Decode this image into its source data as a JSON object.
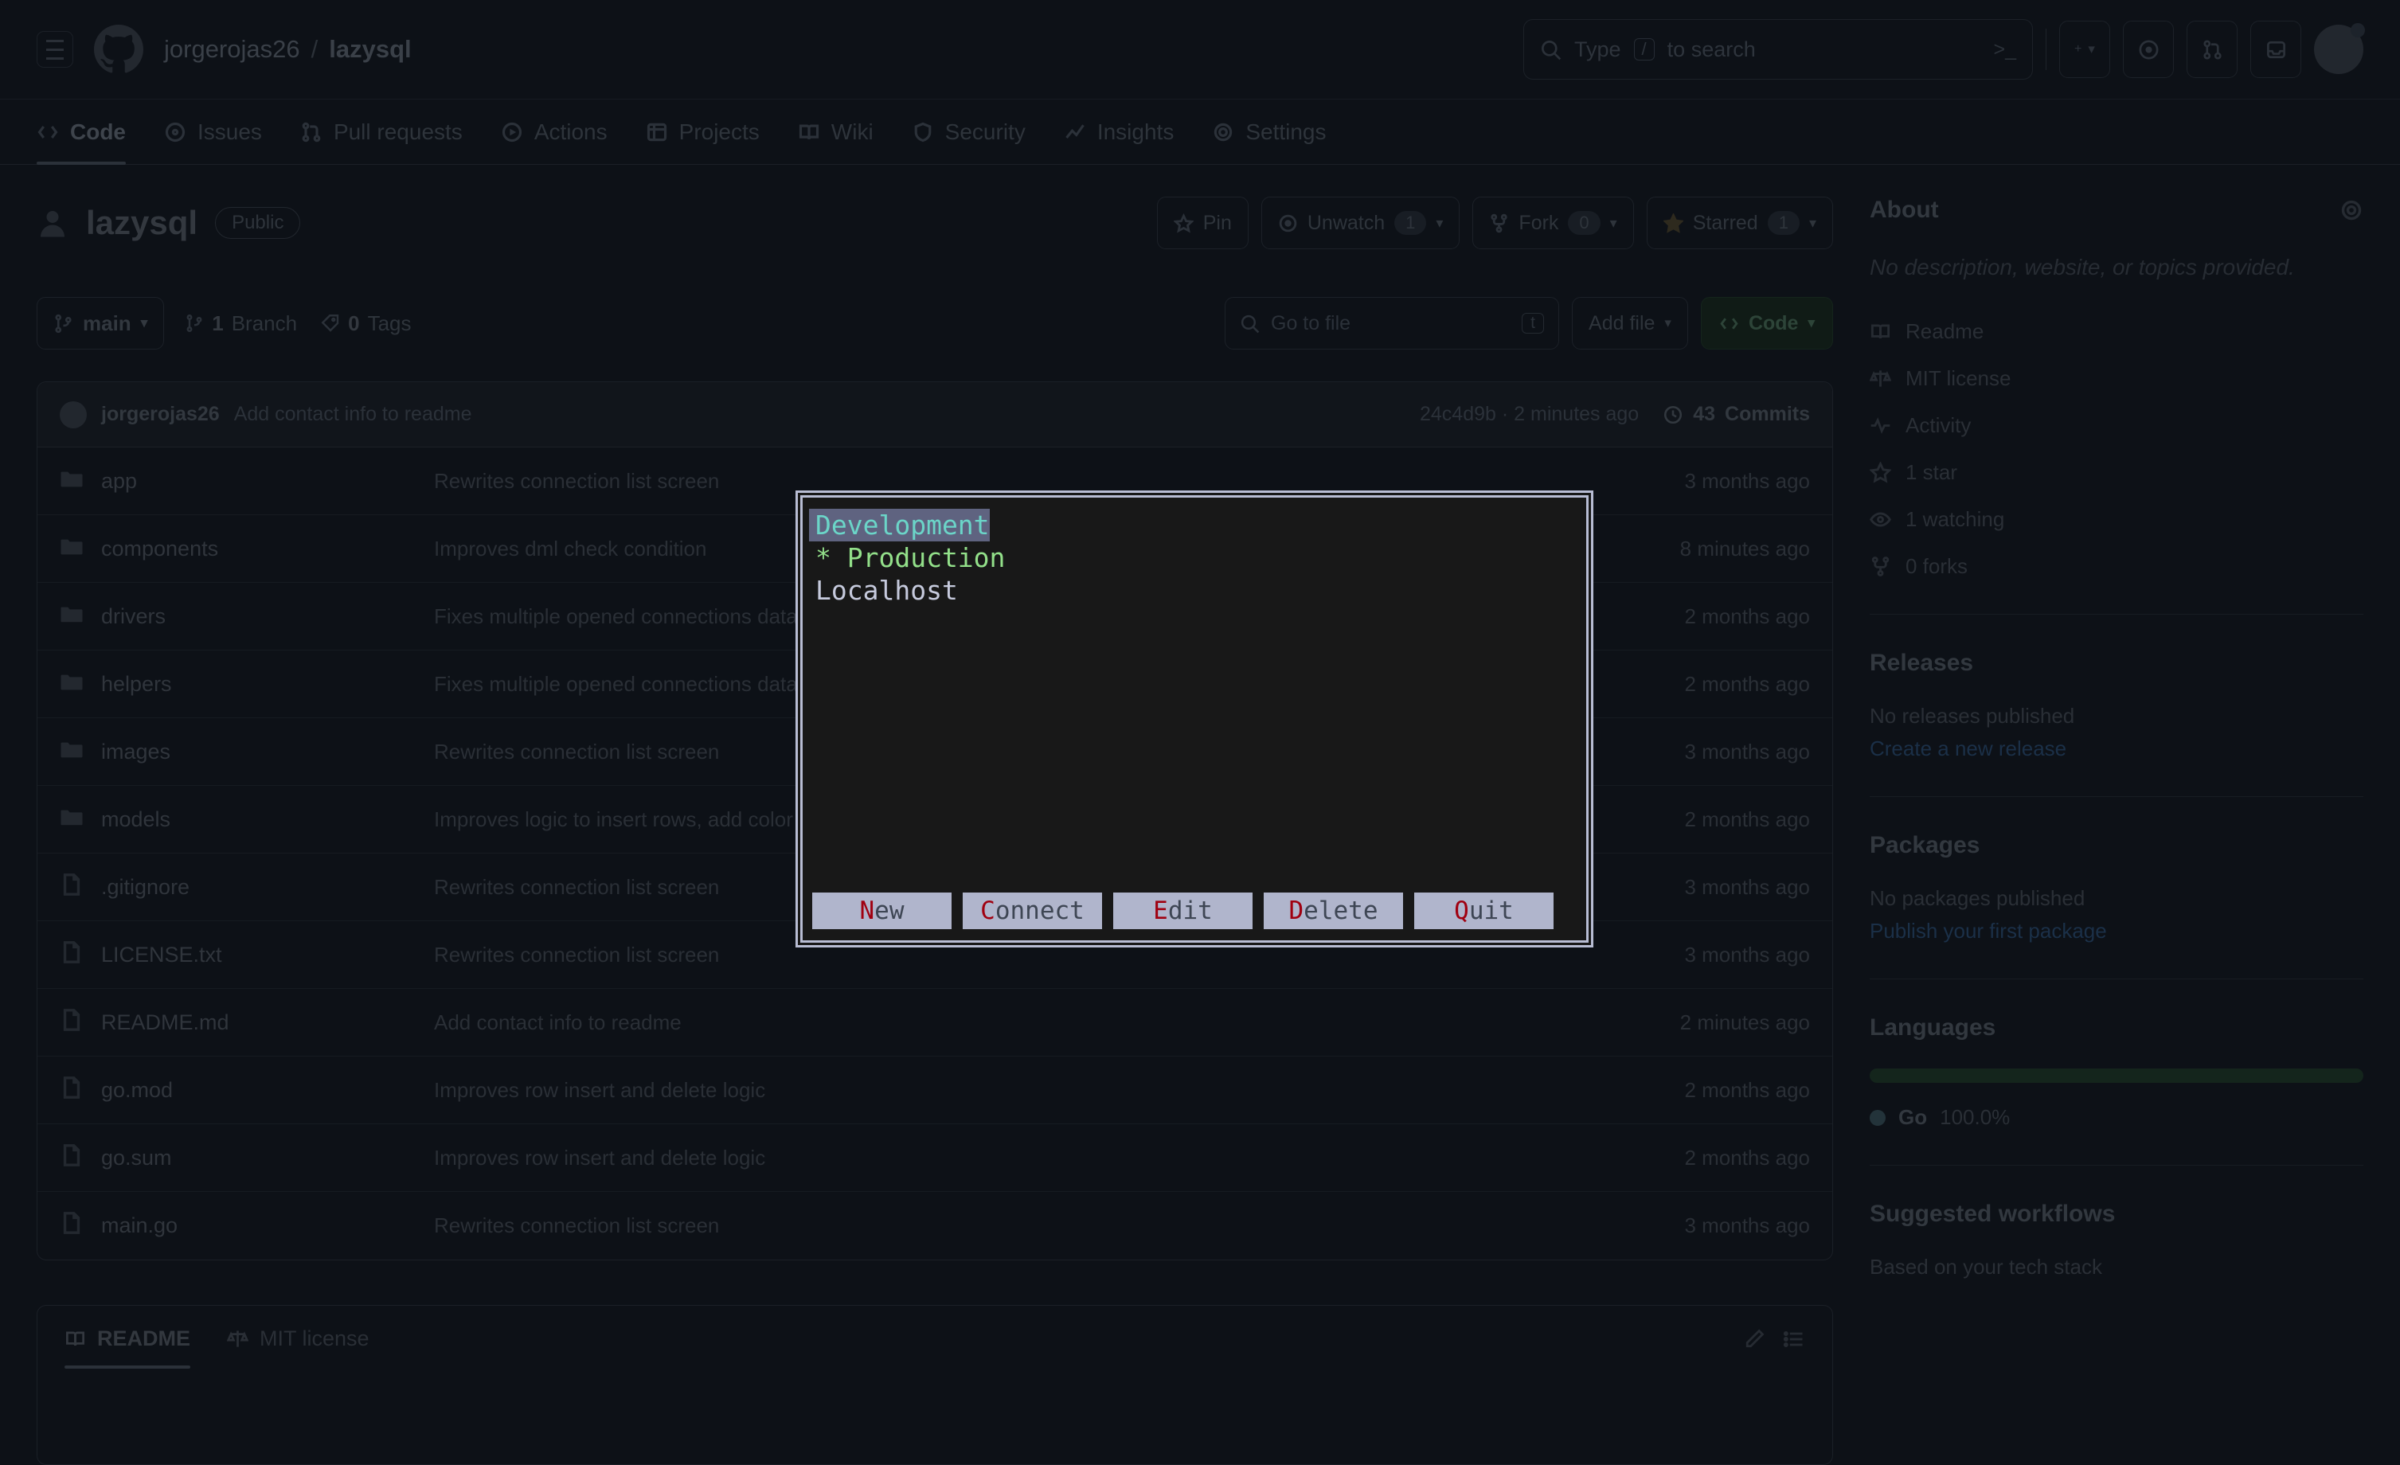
{
  "github": {
    "header": {
      "owner": "jorgerojas26",
      "separator": "/",
      "repo": "lazysql",
      "search_placeholder": "Type  /  to search",
      "search_slash_key": "/",
      "terminal_glyph": ">_",
      "plus_label": "+",
      "caret": "▾"
    },
    "nav": [
      {
        "label": "Code",
        "icon": "code-icon",
        "active": true
      },
      {
        "label": "Issues",
        "icon": "issue-opened-icon",
        "active": false
      },
      {
        "label": "Pull requests",
        "icon": "git-pull-request-icon",
        "active": false
      },
      {
        "label": "Actions",
        "icon": "play-icon",
        "active": false
      },
      {
        "label": "Projects",
        "icon": "table-icon",
        "active": false
      },
      {
        "label": "Wiki",
        "icon": "book-icon",
        "active": false
      },
      {
        "label": "Security",
        "icon": "shield-icon",
        "active": false
      },
      {
        "label": "Insights",
        "icon": "graph-icon",
        "active": false
      },
      {
        "label": "Settings",
        "icon": "gear-icon",
        "active": false
      }
    ],
    "repo": {
      "name": "lazysql",
      "visibility": "Public",
      "actions": {
        "pin": "Pin",
        "watch": "Unwatch",
        "watch_count": "1",
        "fork": "Fork",
        "fork_count": "0",
        "star": "Starred",
        "star_count": "1",
        "caret": "▾"
      }
    },
    "branch_bar": {
      "branch": "main",
      "caret": "▾",
      "branch_count": "1",
      "branch_label": "Branch",
      "tag_count": "0",
      "tag_label": "Tags",
      "go_to_file_placeholder": "Go to file",
      "go_to_file_key": "t",
      "add_file": "Add file",
      "code_button": "Code"
    },
    "commit_header": {
      "author": "jorgerojas26",
      "message": "Add contact info to readme",
      "hash": "24c4d9b",
      "dot": "·",
      "relative_time": "2 minutes ago",
      "commits_count": "43",
      "commits_label": "Commits"
    },
    "files": [
      {
        "name": "app",
        "type": "folder",
        "message": "Rewrites connection list screen",
        "time": "3 months ago"
      },
      {
        "name": "components",
        "type": "folder",
        "message": "Improves dml check condition",
        "time": "8 minutes ago"
      },
      {
        "name": "drivers",
        "type": "folder",
        "message": "Fixes multiple opened connections database instances",
        "time": "2 months ago"
      },
      {
        "name": "helpers",
        "type": "folder",
        "message": "Fixes multiple opened connections database instances",
        "time": "2 months ago"
      },
      {
        "name": "images",
        "type": "folder",
        "message": "Rewrites connection list screen",
        "time": "3 months ago"
      },
      {
        "name": "models",
        "type": "folder",
        "message": "Improves logic to insert rows, add color logic.",
        "time": "2 months ago"
      },
      {
        "name": ".gitignore",
        "type": "file",
        "message": "Rewrites connection list screen",
        "time": "3 months ago"
      },
      {
        "name": "LICENSE.txt",
        "type": "file",
        "message": "Rewrites connection list screen",
        "time": "3 months ago"
      },
      {
        "name": "README.md",
        "type": "file",
        "message": "Add contact info to readme",
        "time": "2 minutes ago"
      },
      {
        "name": "go.mod",
        "type": "file",
        "message": "Improves row insert and delete logic",
        "time": "2 months ago"
      },
      {
        "name": "go.sum",
        "type": "file",
        "message": "Improves row insert and delete logic",
        "time": "2 months ago"
      },
      {
        "name": "main.go",
        "type": "file",
        "message": "Rewrites connection list screen",
        "time": "3 months ago"
      }
    ],
    "readme_tabs": [
      {
        "label": "README",
        "icon": "book-icon",
        "active": true
      },
      {
        "label": "MIT license",
        "icon": "law-icon",
        "active": false
      }
    ],
    "sidebar": {
      "about_title": "About",
      "about_description": "No description, website, or topics provided.",
      "links": [
        {
          "label": "Readme",
          "icon": "book-icon"
        },
        {
          "label": "MIT license",
          "icon": "law-icon"
        },
        {
          "label": "Activity",
          "icon": "pulse-icon"
        },
        {
          "label": "1 star",
          "icon": "star-icon"
        },
        {
          "label": "1 watching",
          "icon": "eye-icon"
        },
        {
          "label": "0 forks",
          "icon": "fork-icon"
        }
      ],
      "releases_title": "Releases",
      "releases_empty": "No releases published",
      "releases_link": "Create a new release",
      "packages_title": "Packages",
      "packages_empty": "No packages published",
      "packages_link": "Publish your first package",
      "languages_title": "Languages",
      "language_name": "Go",
      "language_percent": "100.0%",
      "workflows_title": "Suggested workflows",
      "workflows_subtitle": "Based on your tech stack"
    }
  },
  "dialog": {
    "name": "lazysql-connection-list",
    "items": [
      {
        "text": "Development",
        "state": "selected",
        "color": "#6bd5c8"
      },
      {
        "text": "* Production",
        "state": "marked",
        "color": "#93e08a"
      },
      {
        "text": "Localhost",
        "state": "plain",
        "color": "#c6cadd"
      }
    ],
    "buttons": [
      {
        "hotkey": "N",
        "rest": "ew"
      },
      {
        "hotkey": "C",
        "rest": "onnect"
      },
      {
        "hotkey": "E",
        "rest": "dit"
      },
      {
        "hotkey": "D",
        "rest": "elete"
      },
      {
        "hotkey": "Q",
        "rest": "uit"
      }
    ],
    "colors": {
      "border": "#b8bdd4",
      "background": "#181818",
      "selection": "#5f6380",
      "button_bg": "#b0b5cc",
      "button_text": "#3e4654",
      "hotkey": "#a00010"
    }
  }
}
